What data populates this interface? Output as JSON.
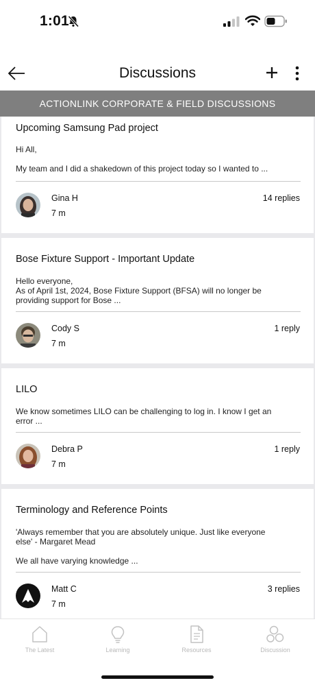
{
  "status_bar": {
    "time": "1:01"
  },
  "header": {
    "title": "Discussions"
  },
  "section": {
    "title": "ACTIONLINK CORPORATE & FIELD DISCUSSIONS"
  },
  "posts": [
    {
      "title": "Upcoming Samsung Pad project",
      "body_lines": [
        "Hi All,",
        "My team and I did a shakedown of this project today so I wanted to ..."
      ],
      "author": "Gina H",
      "time": "7 m",
      "replies": "14 replies"
    },
    {
      "title": "Bose Fixture Support - Important Update",
      "body_lines": [
        "Hello everyone,",
        "As of April 1st, 2024, Bose Fixture Support (BFSA) will no longer be",
        "providing support for Bose ..."
      ],
      "author": "Cody S",
      "time": "7 m",
      "replies": "1 reply"
    },
    {
      "title": "LILO",
      "body_lines": [
        "We know sometimes LILO can be challenging to log in. I know I get an",
        "error ..."
      ],
      "author": "Debra P",
      "time": "7 m",
      "replies": "1 reply"
    },
    {
      "title": "Terminology and Reference Points",
      "body_lines": [
        "'Always remember that you are absolutely unique. Just like everyone",
        "else' - Margaret Mead",
        "We all have varying knowledge ..."
      ],
      "author": "Matt C",
      "time": "7 m",
      "replies": "3 replies"
    }
  ],
  "tabs": [
    {
      "label": "The Latest",
      "icon": "home-icon"
    },
    {
      "label": "Learning",
      "icon": "lightbulb-icon"
    },
    {
      "label": "Resources",
      "icon": "document-icon"
    },
    {
      "label": "Discussion",
      "icon": "discussion-icon"
    }
  ],
  "colors": {
    "banner": "#7f7f7f",
    "feed_background": "#e9e9ec",
    "tab_inactive": "#b9b9b9"
  }
}
